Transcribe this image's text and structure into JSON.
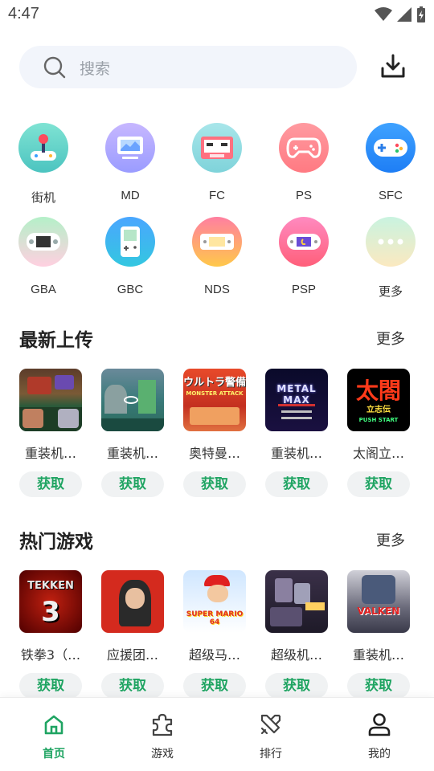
{
  "status": {
    "time": "4:47"
  },
  "search": {
    "placeholder": "搜索"
  },
  "platforms": [
    {
      "label": "街机",
      "icon": "arcade-joystick-icon"
    },
    {
      "label": "MD",
      "icon": "md-monitor-icon"
    },
    {
      "label": "FC",
      "icon": "fc-cartridge-icon"
    },
    {
      "label": "PS",
      "icon": "ps-gamepad-icon"
    },
    {
      "label": "SFC",
      "icon": "sfc-gamepad-icon"
    },
    {
      "label": "GBA",
      "icon": "gba-handheld-icon"
    },
    {
      "label": "GBC",
      "icon": "gbc-handheld-icon"
    },
    {
      "label": "NDS",
      "icon": "nds-handheld-icon"
    },
    {
      "label": "PSP",
      "icon": "psp-handheld-icon"
    },
    {
      "label": "更多",
      "icon": "more-dots-icon"
    }
  ],
  "latest": {
    "title": "最新上传",
    "more": "更多",
    "games": [
      {
        "name": "重装机…",
        "button": "获取"
      },
      {
        "name": "重装机…",
        "button": "获取"
      },
      {
        "name": "奥特曼…",
        "button": "获取"
      },
      {
        "name": "重装机…",
        "button": "获取"
      },
      {
        "name": "太阁立…",
        "button": "获取"
      }
    ]
  },
  "hot": {
    "title": "热门游戏",
    "more": "更多",
    "games": [
      {
        "name": "铁拳3（…",
        "button": "获取"
      },
      {
        "name": "应援团…",
        "button": "获取"
      },
      {
        "name": "超级马…",
        "button": "获取"
      },
      {
        "name": "超级机…",
        "button": "获取"
      },
      {
        "name": "重装机…",
        "button": "获取"
      }
    ]
  },
  "thumb_text": {
    "ultraman": "ウルトラ警備",
    "ultraman_sub": "MONSTER ATTACK",
    "metalmax": "METAL MAX",
    "taiko": "太閤",
    "taiko_sub": "立志伝",
    "taiko_start": "PUSH START",
    "tekken": "TEKKEN",
    "tekken_num": "3",
    "mario": "SUPER MARIO 64",
    "valken": "VALKEN"
  },
  "nav": [
    {
      "label": "首页",
      "icon": "home-icon",
      "active": true
    },
    {
      "label": "游戏",
      "icon": "puzzle-icon",
      "active": false
    },
    {
      "label": "排行",
      "icon": "crossed-swords-icon",
      "active": false
    },
    {
      "label": "我的",
      "icon": "person-icon",
      "active": false
    }
  ],
  "colors": {
    "accent": "#1fa462",
    "button_bg": "#f0f2f3",
    "search_bg": "#f2f5fb"
  }
}
